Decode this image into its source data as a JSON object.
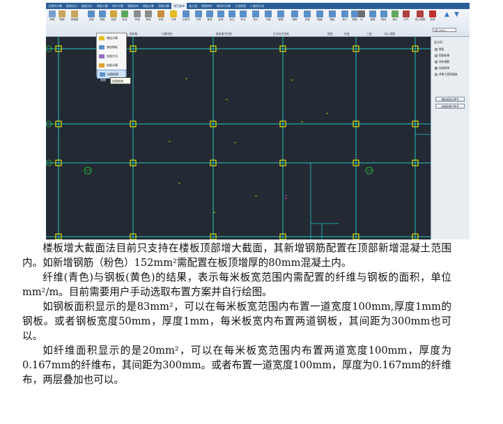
{
  "screenshot": {
    "ribbon_tabs": [
      "主模块计算",
      "基础设计",
      "楼板设计",
      "钢板计算",
      "构件计算",
      "钢筋排布",
      "楼板计算",
      "荷载计算",
      "规范查询",
      "施工图",
      "预制构件",
      "钢构件计算",
      "工程管理",
      "二维码生成"
    ],
    "ribbon_buttons": [
      {
        "label": "荷载",
        "color": "#7a9fcf"
      },
      {
        "label": "数据",
        "color": "#c9a45c"
      },
      {
        "label": "荷载图",
        "color": "#c9a45c"
      },
      {
        "label": "实配",
        "color": "#5c8fc9"
      },
      {
        "label": "楼板",
        "color": "#5c8fc9"
      },
      {
        "label": "加固",
        "color": "#d1a53d"
      },
      {
        "label": "安全",
        "color": "#62a85c"
      },
      {
        "label": "传递",
        "color": "#8c8c8c"
      },
      {
        "label": "修改",
        "color": "#8c8c8c"
      },
      {
        "label": "包络",
        "color": "#c98c3d"
      },
      {
        "label": "计算",
        "color": "#e0c020"
      },
      {
        "label": "计算书",
        "color": "#5c8fc9"
      },
      {
        "label": "计算",
        "color": "#5c8fc9"
      },
      {
        "label": "复核",
        "color": "#5c8fc9"
      },
      {
        "label": "负荷",
        "color": "#5c8fc9"
      },
      {
        "label": "标注",
        "color": "#5c8fc9"
      },
      {
        "label": "拆分",
        "color": "#5c8fc9"
      },
      {
        "label": "显示",
        "color": "#5c8fc9"
      },
      {
        "label": "平面",
        "color": "#5c8fc9"
      },
      {
        "label": "配筋",
        "color": "#5c8fc9"
      },
      {
        "label": "钢筋",
        "color": "#5c8fc9"
      },
      {
        "label": "负筋",
        "color": "#5c8fc9"
      },
      {
        "label": "裂缝",
        "color": "#5c8fc9"
      },
      {
        "label": "钢板",
        "color": "#5c8fc9"
      },
      {
        "label": "统计",
        "color": "#5c8fc9"
      },
      {
        "label": "表格",
        "color": "#5c8fc9"
      },
      {
        "label": "As",
        "color": "#6d6d6d"
      },
      {
        "label": "钢筋",
        "color": "#5c8fc9"
      },
      {
        "label": "图名",
        "color": "#5c8fc9"
      },
      {
        "label": "统计",
        "color": "#62a85c"
      },
      {
        "label": "打开",
        "color": "#b04040"
      },
      {
        "label": "插入钢筋",
        "color": "#b04040"
      },
      {
        "label": "选择",
        "color": "#c03030"
      }
    ],
    "ribbon_groups": [
      "楼参数",
      "计算控制",
      "楼板集中控制",
      "文字标注控制",
      "图面",
      "补强",
      "三维",
      "插入钢筋"
    ],
    "dropdown": {
      "items": [
        "增加计算",
        "施加钢板",
        "加固方法",
        "加固计算",
        "加固结果"
      ],
      "highlight_index": 4
    },
    "tooltip": "加固结果",
    "tooltip_stub": "加固",
    "axis_labels": [
      "1/1",
      "1/3"
    ],
    "side_panel": {
      "title": "显示项",
      "options": [
        "楼板",
        "配筋结果",
        "所有钢筋",
        "加固结果",
        "承载力提高幅度"
      ],
      "selected_index": 3,
      "buttons": [
        "楼板加固计算书",
        "加固结果计算书"
      ],
      "top_field": "1层  2900  1"
    },
    "colors": {
      "canvas_bg": "#232a33",
      "grid_cyan": "#22c6c6",
      "column_yellow": "#ffff00",
      "axis_green": "#2ecc40",
      "label_yellow": "#e6e600",
      "label_pink": "#ff44ff"
    }
  },
  "paragraphs": [
    "楼板增大截面法目前只支持在楼板顶部增大截面，其新增钢筋配置在顶部新增混凝土范围内。如新增钢筋（粉色）152mm²需配置在板顶增厚的80mm混凝土内。",
    "纤维(青色)与钢板(黄色)的结果，表示每米板宽范围内需配置的纤维与钢板的面积，单位mm²/m。目前需要用户手动选取布置方案并自行绘图。",
    "如钢板面积显示的是83mm²，可以在每米板宽范围内布置一道宽度100mm,厚度1mm的钢板。或者钢板宽度50mm，厚度1mm，每米板宽内布置两道钢板，其间距为300mm也可以。",
    "如纤维面积显示的是20mm²，可以在每米板宽范围内布置两道宽度100mm，厚度为0.167mm的纤维布，其间距为300mm。或者布置一道宽度100mm，厚度为0.167mm的纤维布，两层叠加也可以。"
  ]
}
